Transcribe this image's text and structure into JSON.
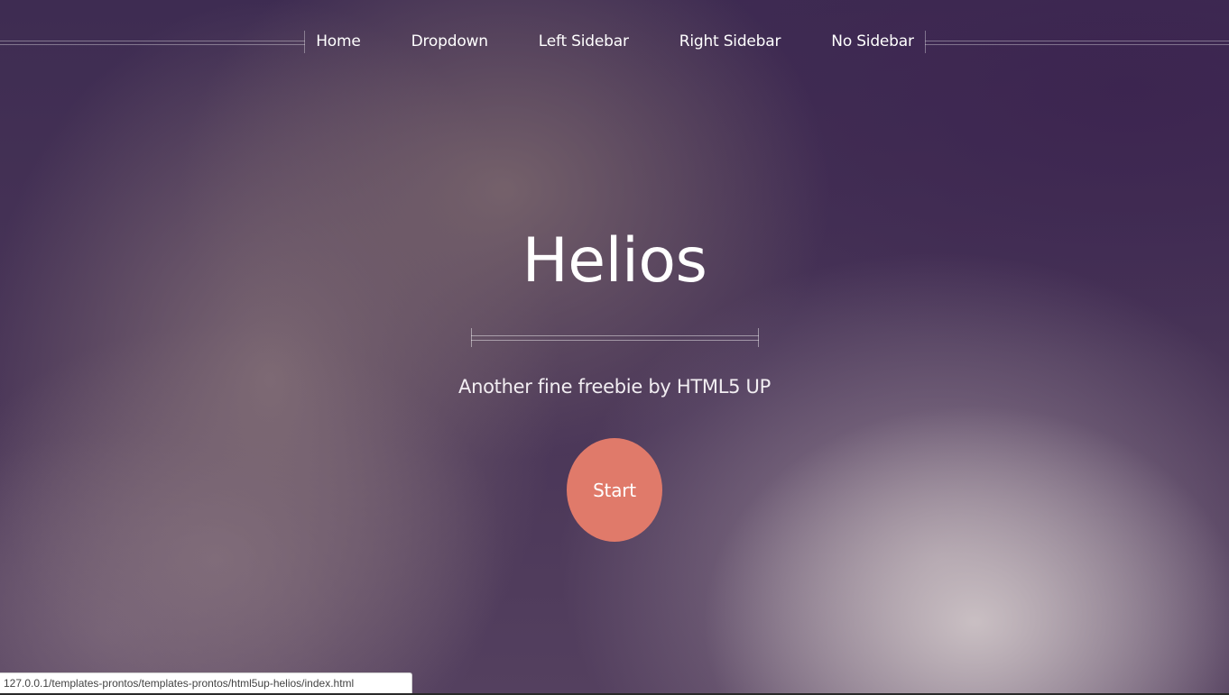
{
  "nav": {
    "items": [
      {
        "label": "Home"
      },
      {
        "label": "Dropdown"
      },
      {
        "label": "Left Sidebar"
      },
      {
        "label": "Right Sidebar"
      },
      {
        "label": "No Sidebar"
      }
    ]
  },
  "header": {
    "title": "Helios",
    "tagline": "Another fine freebie by HTML5 UP",
    "button_label": "Start"
  },
  "status_bar": {
    "url": "127.0.0.1/templates-prontos/templates-prontos/html5up-helios/index.html"
  },
  "colors": {
    "button": "#e07a6a",
    "background": "#3e2c52"
  }
}
